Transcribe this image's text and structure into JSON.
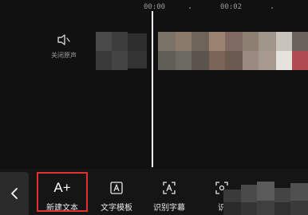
{
  "ruler": {
    "t0": "00:00",
    "t1": "00:02"
  },
  "audio": {
    "mute_label": "关闭原声"
  },
  "toolbar": {
    "new_text_label": "新建文本",
    "new_text_glyph": "A+",
    "text_template_label": "文字模板",
    "recognize_subtitle_label": "识别字幕",
    "recognize_lyrics_label": "识"
  },
  "colors": {
    "background": "#111111",
    "toolbar_bg": "#151515",
    "back_button_bg": "#2b2b2b",
    "playhead": "#ffffff",
    "highlight_border": "#e0312f"
  }
}
